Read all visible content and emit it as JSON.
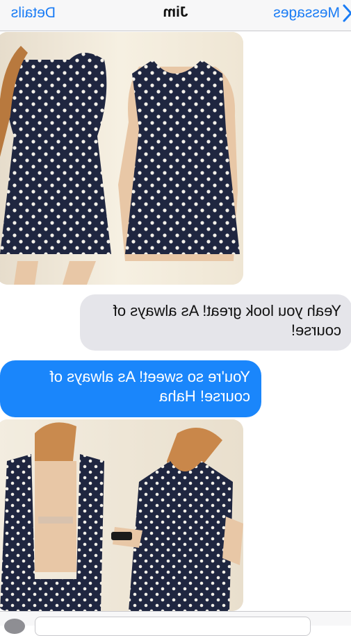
{
  "nav": {
    "back_label": "Messages",
    "title": "Jim",
    "details_label": "Details"
  },
  "messages": [
    {
      "type": "image",
      "from": "me",
      "description": "photo"
    },
    {
      "type": "text",
      "from": "them",
      "text": "Yeah you look great! As always of course!"
    },
    {
      "type": "text",
      "from": "me",
      "text": "You're so sweet! As always of course! Haha"
    },
    {
      "type": "image",
      "from": "me",
      "description": "photo"
    }
  ],
  "colors": {
    "accent": "#1a7cf5",
    "outgoing_bubble": "#1a86fb",
    "incoming_bubble": "#e5e5ea"
  },
  "icons": {
    "back": "chevron-left-icon",
    "camera": "camera-icon"
  }
}
